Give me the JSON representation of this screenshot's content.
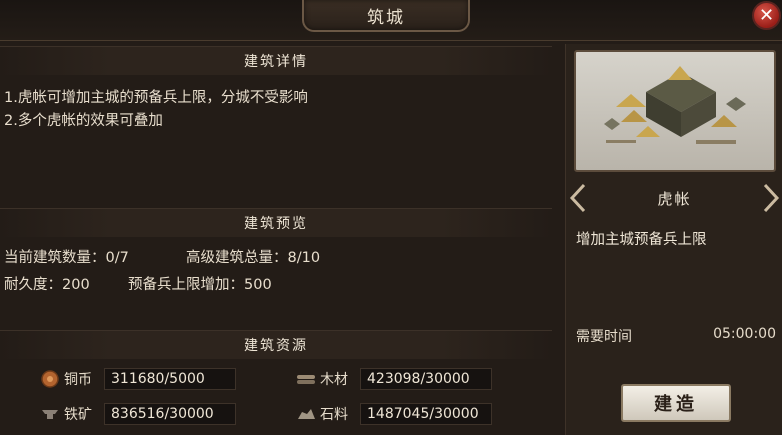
{
  "window": {
    "title": "筑城",
    "close_label": "✕"
  },
  "details": {
    "heading": "建筑详情",
    "lines": [
      "1.虎帐可增加主城的预备兵上限，分城不受影响",
      "2.多个虎帐的效果可叠加"
    ]
  },
  "preview": {
    "heading": "建筑预览",
    "count_label": "当前建筑数量：0/7",
    "total_label": "高级建筑总量：8/10",
    "durability_label": "耐久度：200",
    "reserve_label": "预备兵上限增加：500"
  },
  "resources": {
    "heading": "建筑资源",
    "items": [
      {
        "name": "铜币",
        "value": "311680/5000",
        "icon": "coin-icon"
      },
      {
        "name": "木材",
        "value": "423098/30000",
        "icon": "wood-icon"
      },
      {
        "name": "铁矿",
        "value": "836516/30000",
        "icon": "iron-icon"
      },
      {
        "name": "石料",
        "value": "1487045/30000",
        "icon": "stone-icon"
      }
    ]
  },
  "building": {
    "name": "虎帐",
    "description": "增加主城预备兵上限",
    "time_label": "需要时间",
    "time_value": "05:00:00",
    "build_label": "建造"
  }
}
